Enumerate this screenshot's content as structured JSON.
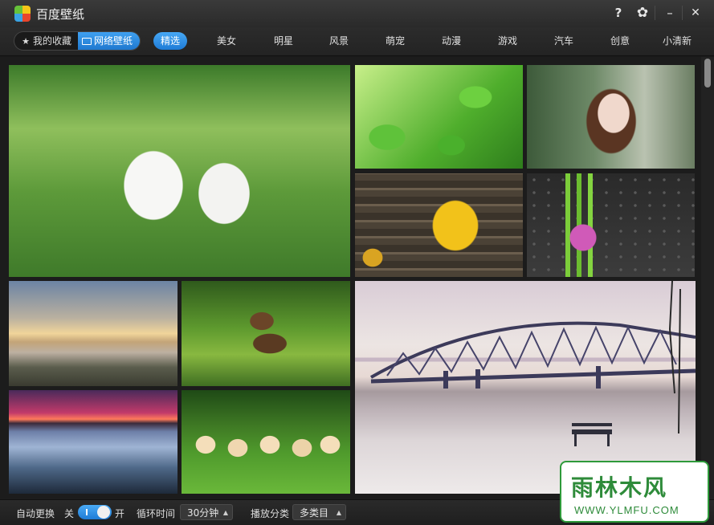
{
  "window": {
    "title": "百度壁纸"
  },
  "titlebar": {
    "help": "?",
    "settings": "✿",
    "minimize": "–",
    "close": "✕"
  },
  "source_tabs": [
    {
      "label": "我的收藏",
      "icon": "star-icon",
      "selected": false
    },
    {
      "label": "网络壁纸",
      "icon": "monitor-icon",
      "selected": true
    }
  ],
  "categories": [
    "精选",
    "美女",
    "明星",
    "风景",
    "萌宠",
    "动漫",
    "游戏",
    "汽车",
    "创意",
    "小清新"
  ],
  "active_category": "精选",
  "gallery": [
    "puppies-in-flower-field",
    "green-leaves",
    "girl-portrait",
    "yellow-maple-leaf",
    "pink-orchid-on-bamboo",
    "misty-lake-sunrise",
    "bear-cubs",
    "sunset-over-sea",
    "golden-retriever-puppies",
    "bridge-over-frozen-river"
  ],
  "bottombar": {
    "auto_change_label": "自动更换",
    "off_label": "关",
    "on_label": "开",
    "auto_change_on": true,
    "interval_label": "循环时间",
    "interval_value": "30分钟",
    "category_label": "播放分类",
    "category_value": "多类目"
  },
  "watermark": {
    "text": "雨林木风",
    "url": "WWW.YLMFU.COM"
  },
  "colors": {
    "accent": "#2a8ae6",
    "background": "#1b1b1b",
    "watermark": "#2e8b3a"
  }
}
